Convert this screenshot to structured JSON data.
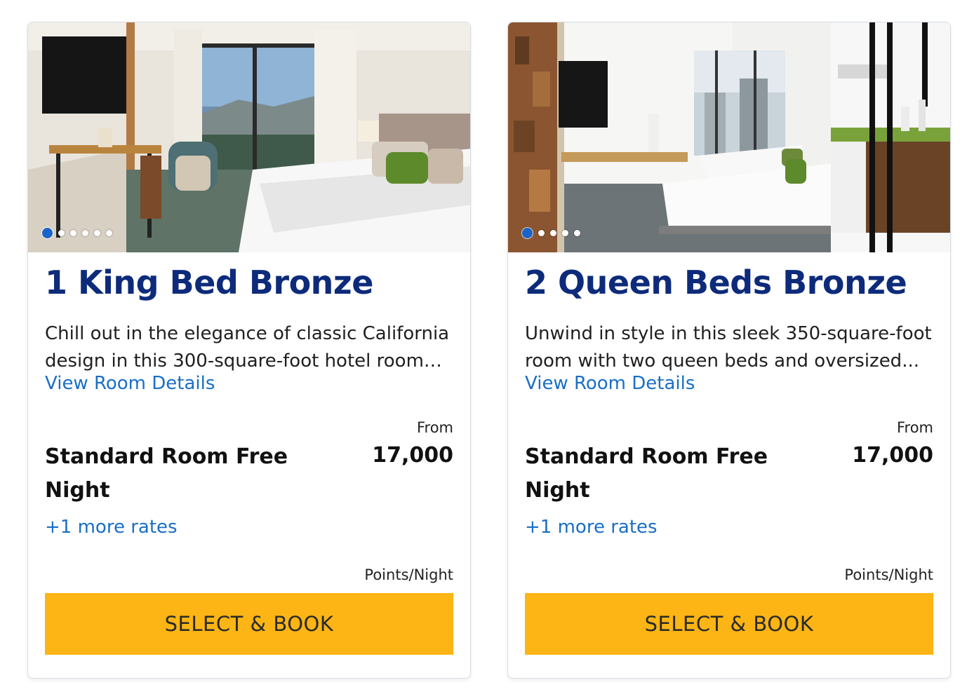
{
  "rooms": [
    {
      "title": "1 King Bed Bronze",
      "description": "Chill out in the elegance of classic California design in this 300-square-foot hotel room wit...",
      "details_link": "View Room Details",
      "from_label": "From",
      "rate_name": "Standard Room Free Night",
      "price": "17,000",
      "more_rates": "+1 more rates",
      "points_label": "Points/Night",
      "book_button": "SELECT & BOOK",
      "carousel": {
        "total_slides": 6,
        "active_slide": 1
      }
    },
    {
      "title": "2 Queen Beds Bronze",
      "description": "Unwind in style in this sleek 350-square-foot room with two queen beds and oversized...",
      "details_link": "View Room Details",
      "from_label": "From",
      "rate_name": "Standard Room Free Night",
      "price": "17,000",
      "more_rates": "+1 more rates",
      "points_label": "Points/Night",
      "book_button": "SELECT & BOOK",
      "carousel": {
        "total_slides": 5,
        "active_slide": 1
      }
    }
  ],
  "colors": {
    "title": "#0d2b7a",
    "link": "#1a6fc4",
    "button": "#fcb514",
    "carousel_active": "#1a63c9"
  }
}
